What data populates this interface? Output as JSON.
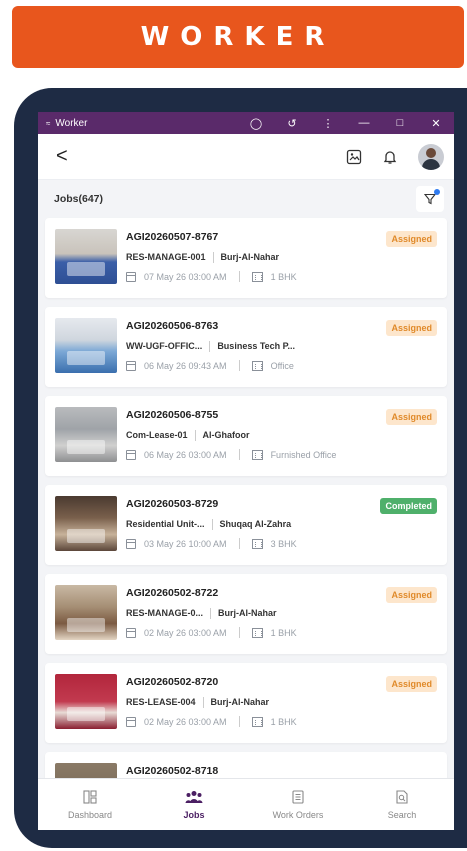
{
  "banner": {
    "title": "WORKER"
  },
  "window": {
    "title": "Worker"
  },
  "header": {
    "back": "<"
  },
  "subheader": {
    "jobs_label": "Jobs(647)"
  },
  "colors": {
    "brand_orange": "#e8561d",
    "titlebar": "#5a2a6a",
    "assigned": "#e08a2a",
    "completed": "#4fb06b",
    "nav_active": "#4b1f63"
  },
  "jobs": [
    {
      "id": "AGI20260507-8767",
      "ref": "RES-MANAGE-001",
      "location": "Burj-Al-Nahar",
      "date": "07 May 26 03:00 AM",
      "unit": "1 BHK",
      "status": "Assigned"
    },
    {
      "id": "AGI20260506-8763",
      "ref": "WW-UGF-OFFIC...",
      "location": "Business Tech P...",
      "date": "06 May 26 09:43 AM",
      "unit": "Office",
      "status": "Assigned"
    },
    {
      "id": "AGI20260506-8755",
      "ref": "Com-Lease-01",
      "location": "Al-Ghafoor",
      "date": "06 May 26 03:00 AM",
      "unit": "Furnished Office",
      "status": "Assigned"
    },
    {
      "id": "AGI20260503-8729",
      "ref": "Residential Unit-...",
      "location": "Shuqaq Al-Zahra",
      "date": "03 May 26 10:00 AM",
      "unit": "3 BHK",
      "status": "Completed"
    },
    {
      "id": "AGI20260502-8722",
      "ref": "RES-MANAGE-0...",
      "location": "Burj-Al-Nahar",
      "date": "02 May 26 03:00 AM",
      "unit": "1 BHK",
      "status": "Assigned"
    },
    {
      "id": "AGI20260502-8720",
      "ref": "RES-LEASE-004",
      "location": "Burj-Al-Nahar",
      "date": "02 May 26 03:00 AM",
      "unit": "1 BHK",
      "status": "Assigned"
    },
    {
      "id": "AGI20260502-8718",
      "ref": "",
      "location": "",
      "date": "",
      "unit": "",
      "status": ""
    }
  ],
  "nav": [
    {
      "label": "Dashboard",
      "icon": "dashboard-icon"
    },
    {
      "label": "Jobs",
      "icon": "jobs-icon",
      "active": true
    },
    {
      "label": "Work Orders",
      "icon": "work-orders-icon"
    },
    {
      "label": "Search",
      "icon": "search-icon"
    }
  ]
}
